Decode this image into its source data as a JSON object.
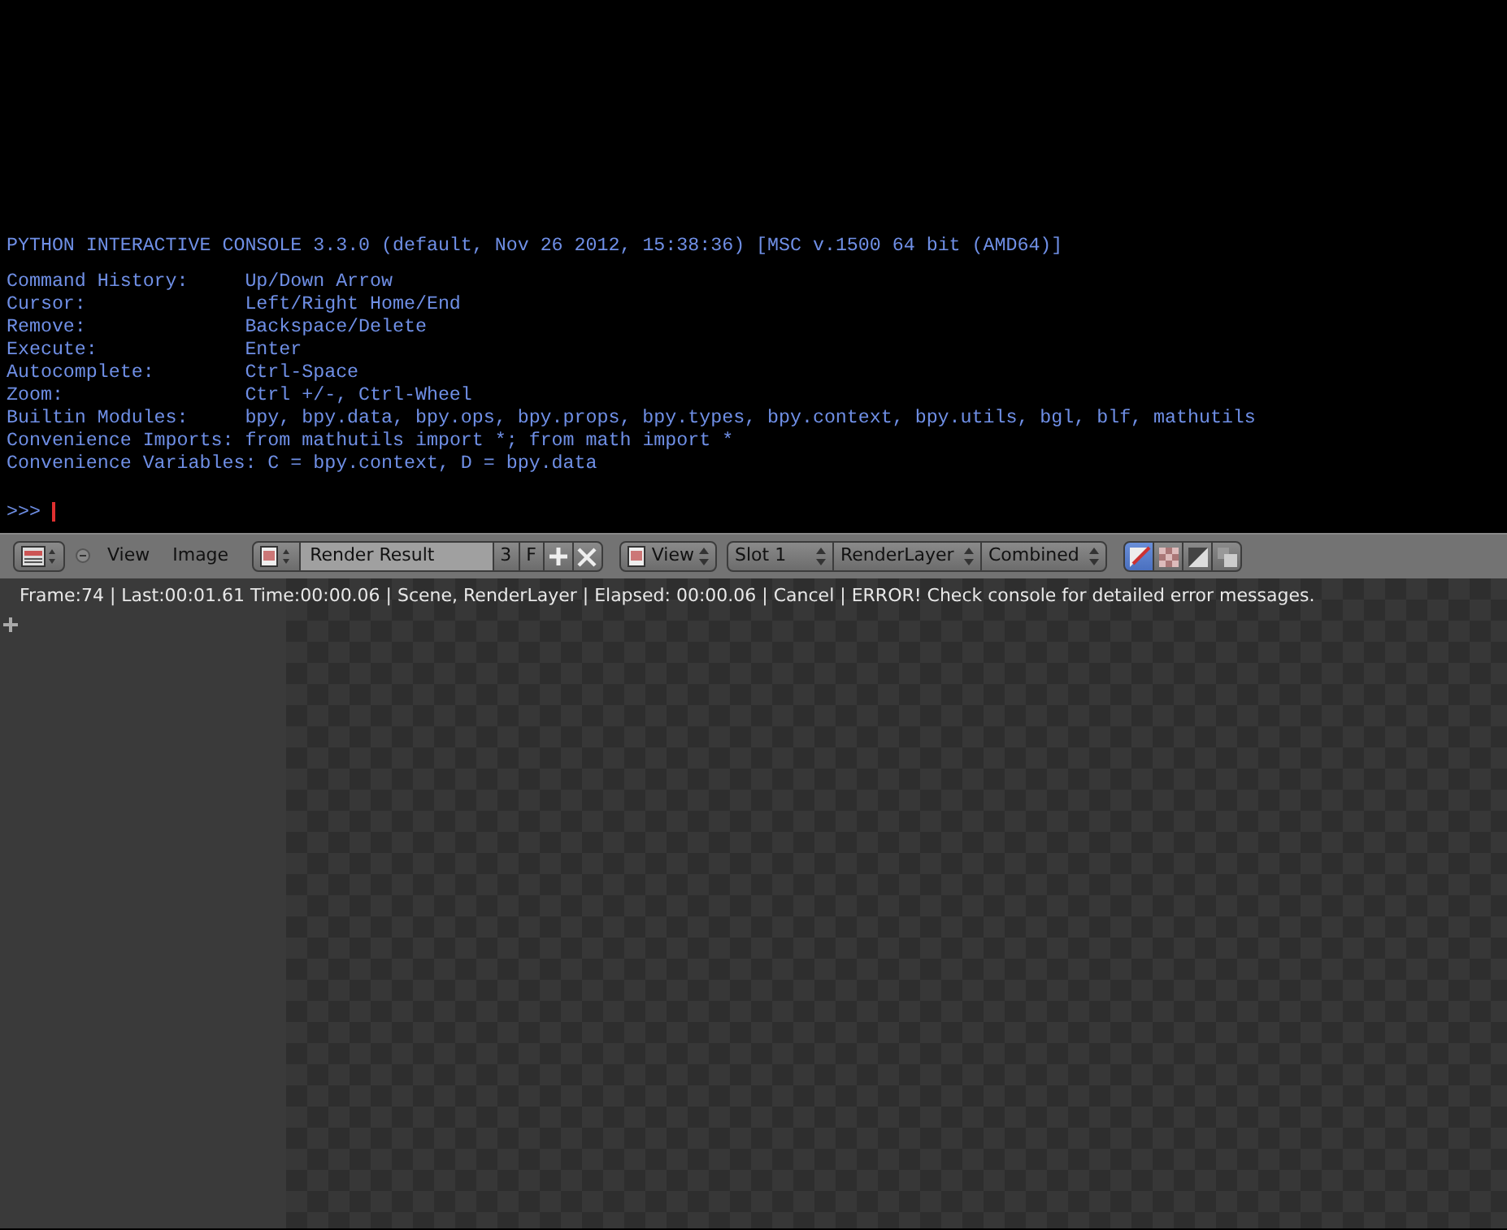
{
  "console": {
    "banner": "PYTHON INTERACTIVE CONSOLE 3.3.0 (default, Nov 26 2012, 15:38:36) [MSC v.1500 64 bit (AMD64)]",
    "help": [
      {
        "key": "Command History:",
        "value": "Up/Down Arrow"
      },
      {
        "key": "Cursor:",
        "value": "Left/Right Home/End"
      },
      {
        "key": "Remove:",
        "value": "Backspace/Delete"
      },
      {
        "key": "Execute:",
        "value": "Enter"
      },
      {
        "key": "Autocomplete:",
        "value": "Ctrl-Space"
      },
      {
        "key": "Zoom:",
        "value": "Ctrl +/-, Ctrl-Wheel"
      },
      {
        "key": "Builtin Modules:",
        "value": "bpy, bpy.data, bpy.ops, bpy.props, bpy.types, bpy.context, bpy.utils, bgl, blf, mathutils"
      },
      {
        "key": "Convenience Imports:",
        "value": "from mathutils import *; from math import *"
      },
      {
        "key": "Convenience Variables:",
        "value": "C = bpy.context, D = bpy.data"
      }
    ],
    "prompt": ">>>"
  },
  "toolbar": {
    "menus": [
      "View",
      "Image"
    ],
    "image_name": "Render Result",
    "users": "3",
    "fake_user": "F",
    "view_menu": "View",
    "dropdowns": [
      "Slot 1",
      "RenderLayer",
      "Combined"
    ],
    "draw_modes": [
      {
        "selected": true
      },
      {
        "selected": false
      },
      {
        "selected": false
      },
      {
        "selected": false
      }
    ]
  },
  "status": "Frame:74 | Last:00:01.61 Time:00:00.06 | Scene, RenderLayer | Elapsed: 00:00.06 | Cancel | ERROR! Check console for detailed error messages."
}
